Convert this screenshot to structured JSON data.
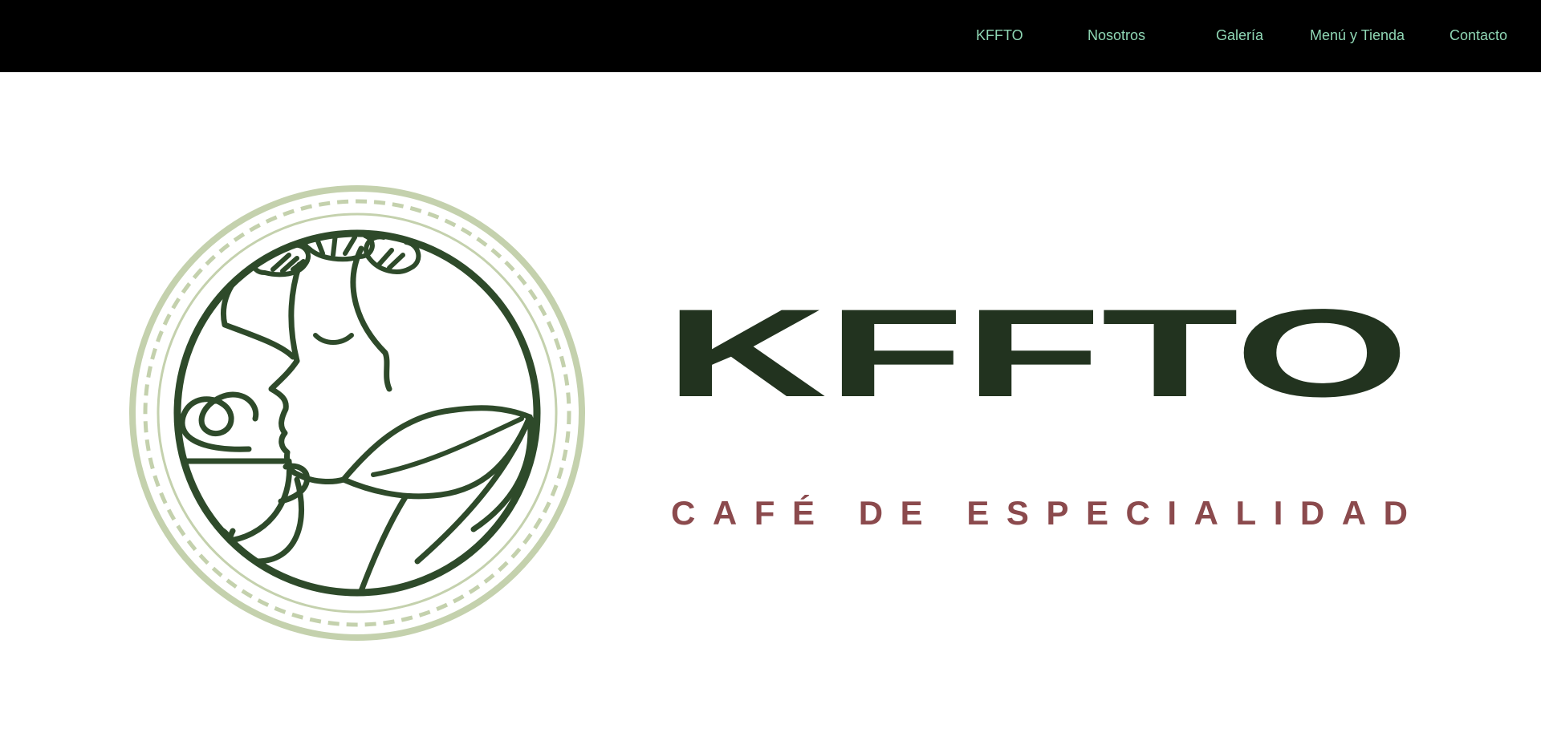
{
  "colors": {
    "nav_bg": "#000000",
    "nav_text": "#8fd6b4",
    "brand_dark_green": "#22331f",
    "emblem_line_green": "#2e4a2a",
    "emblem_ring_sage": "#c4d1ad",
    "tagline_wine": "#8b4a4d",
    "page_bg": "#ffffff"
  },
  "nav": {
    "items": [
      {
        "label": "KFFTO"
      },
      {
        "label": "Nosotros"
      },
      {
        "label": "Galería"
      },
      {
        "label": "Menú y Tienda"
      },
      {
        "label": "Contacto"
      }
    ]
  },
  "hero": {
    "emblem_icon": "woman-with-coffee-cup-emblem-icon",
    "brand_name": "KFFTO",
    "tagline": "CAFÉ DE ESPECIALIDAD"
  }
}
